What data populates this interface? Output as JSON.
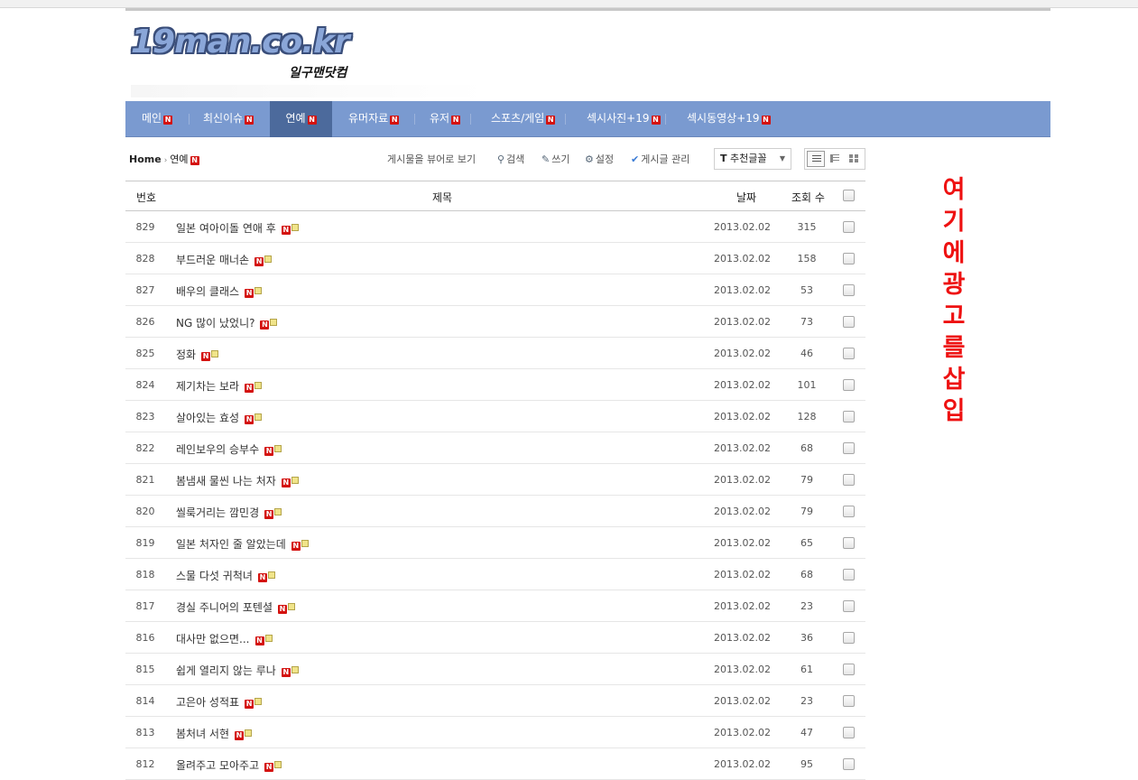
{
  "logo": {
    "text": "19man.co.kr",
    "sub": "일구맨닷컴"
  },
  "nav": [
    {
      "label": "메인",
      "badge": "N"
    },
    {
      "label": "최신이슈",
      "badge": "N"
    },
    {
      "label": "연예",
      "badge": "N",
      "active": true
    },
    {
      "label": "유머자료",
      "badge": "N"
    },
    {
      "label": "유저",
      "badge": "N"
    },
    {
      "label": "스포츠/게임",
      "badge": "N"
    },
    {
      "label": "섹시사진+19",
      "badge": "N"
    },
    {
      "label": "섹시동영상+19",
      "badge": "N"
    }
  ],
  "breadcrumb": {
    "home": "Home",
    "current": "연예",
    "badge": "N"
  },
  "toolbar": {
    "web_view": "게시물을 뷰어로 보기",
    "search": "검색",
    "write": "쓰기",
    "settings": "설정",
    "manage": "게시글 관리",
    "sort_icon": "T",
    "sort_value": "추천글꼴"
  },
  "table": {
    "headers": {
      "no": "번호",
      "title": "제목",
      "date": "날짜",
      "views": "조회 수"
    },
    "rows": [
      {
        "no": "829",
        "title": "일본 여아이돌 연애 후",
        "date": "2013.02.02",
        "views": "315"
      },
      {
        "no": "828",
        "title": "부드러운 매너손",
        "date": "2013.02.02",
        "views": "158"
      },
      {
        "no": "827",
        "title": "배우의 클래스",
        "date": "2013.02.02",
        "views": "53"
      },
      {
        "no": "826",
        "title": "NG 많이 났었니?",
        "date": "2013.02.02",
        "views": "73"
      },
      {
        "no": "825",
        "title": "정화",
        "date": "2013.02.02",
        "views": "46"
      },
      {
        "no": "824",
        "title": "제기차는 보라",
        "date": "2013.02.02",
        "views": "101"
      },
      {
        "no": "823",
        "title": "살아있는 효성",
        "date": "2013.02.02",
        "views": "128"
      },
      {
        "no": "822",
        "title": "레인보우의 승부수",
        "date": "2013.02.02",
        "views": "68"
      },
      {
        "no": "821",
        "title": "봄냄새 물씬 나는 처자",
        "date": "2013.02.02",
        "views": "79"
      },
      {
        "no": "820",
        "title": "씰룩거리는 깜민경",
        "date": "2013.02.02",
        "views": "79"
      },
      {
        "no": "819",
        "title": "일본 처자인 줄 알았는데",
        "date": "2013.02.02",
        "views": "65"
      },
      {
        "no": "818",
        "title": "스물 다섯 귀척녀",
        "date": "2013.02.02",
        "views": "68"
      },
      {
        "no": "817",
        "title": "경실 주니어의 포텐셜",
        "date": "2013.02.02",
        "views": "23"
      },
      {
        "no": "816",
        "title": "대사만 없으면...",
        "date": "2013.02.02",
        "views": "36"
      },
      {
        "no": "815",
        "title": "쉽게 열리지 않는 루나",
        "date": "2013.02.02",
        "views": "61"
      },
      {
        "no": "814",
        "title": "고은아 성적표",
        "date": "2013.02.02",
        "views": "23"
      },
      {
        "no": "813",
        "title": "봄처녀 서현",
        "date": "2013.02.02",
        "views": "47"
      },
      {
        "no": "812",
        "title": "올려주고 모아주고",
        "date": "2013.02.02",
        "views": "95"
      }
    ]
  },
  "ad_text": [
    "여",
    "기",
    "에",
    "광",
    "고",
    "를",
    "삽",
    "입"
  ],
  "colors": {
    "nav_bg": "#7a9ad0",
    "nav_active": "#4c6a9c",
    "badge": "#d4120f",
    "ad": "#ee1111"
  }
}
